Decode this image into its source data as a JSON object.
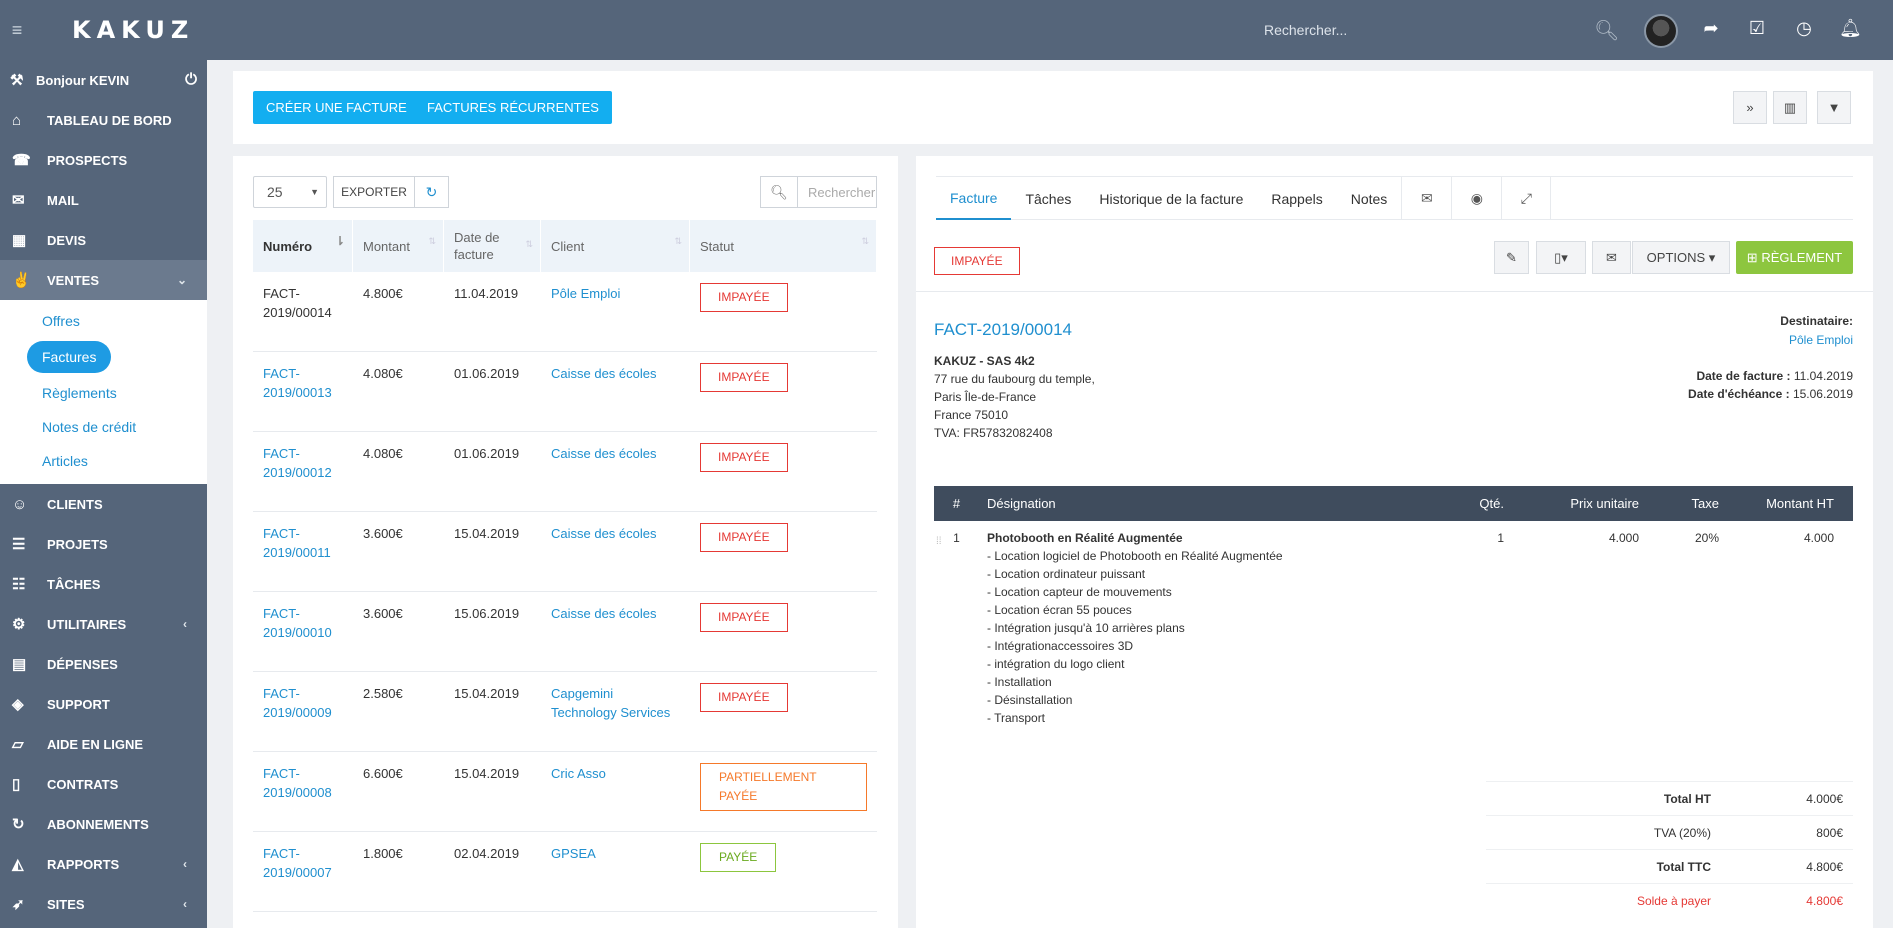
{
  "app": {
    "logo": "KAKUZ",
    "search_placeholder": "Rechercher..."
  },
  "sidebar": {
    "greeting": "Bonjour KEVIN",
    "items_top": [
      {
        "label": "TABLEAU DE BORD",
        "icon": "home-icon"
      },
      {
        "label": "PROSPECTS",
        "icon": "phone-icon"
      },
      {
        "label": "MAIL",
        "icon": "mail-icon"
      },
      {
        "label": "DEVIS",
        "icon": "calculator-icon"
      }
    ],
    "ventes": {
      "label": "VENTES",
      "icon": "victory-hand-icon",
      "sub": [
        "Offres",
        "Factures",
        "Règlements",
        "Notes de crédit",
        "Articles"
      ]
    },
    "items_bottom": [
      {
        "label": "CLIENTS",
        "icon": "user-icon"
      },
      {
        "label": "PROJETS",
        "icon": "bars-icon"
      },
      {
        "label": "TÂCHES",
        "icon": "tasks-icon"
      },
      {
        "label": "UTILITAIRES",
        "icon": "gears-icon"
      },
      {
        "label": "DÉPENSES",
        "icon": "file-icon"
      },
      {
        "label": "SUPPORT",
        "icon": "ticket-icon"
      },
      {
        "label": "AIDE EN LIGNE",
        "icon": "folder-open-icon"
      },
      {
        "label": "CONTRATS",
        "icon": "document-icon"
      },
      {
        "label": "ABONNEMENTS",
        "icon": "refresh-icon"
      },
      {
        "label": "RAPPORTS",
        "icon": "area-chart-icon"
      },
      {
        "label": "SITES",
        "icon": "rocket-icon"
      }
    ]
  },
  "toolbar": {
    "create_invoice": "CRÉER UNE FACTURE",
    "recurring_invoices": "FACTURES RÉCURRENTES"
  },
  "list": {
    "page_size": "25",
    "export_label": "EXPORTER",
    "search_placeholder": "Rechercher",
    "columns": [
      "Numéro",
      "Montant",
      "Date de facture",
      "Client",
      "Statut"
    ],
    "rows": [
      {
        "num": "FACT-2019/00014",
        "amount": "4.800€",
        "date": "11.04.2019",
        "client": "Pôle Emploi",
        "status": "IMPAYÉE"
      },
      {
        "num": "FACT-2019/00013",
        "amount": "4.080€",
        "date": "01.06.2019",
        "client": "Caisse des écoles",
        "status": "IMPAYÉE"
      },
      {
        "num": "FACT-2019/00012",
        "amount": "4.080€",
        "date": "01.06.2019",
        "client": "Caisse des écoles",
        "status": "IMPAYÉE"
      },
      {
        "num": "FACT-2019/00011",
        "amount": "3.600€",
        "date": "15.04.2019",
        "client": "Caisse des écoles",
        "status": "IMPAYÉE"
      },
      {
        "num": "FACT-2019/00010",
        "amount": "3.600€",
        "date": "15.06.2019",
        "client": "Caisse des écoles",
        "status": "IMPAYÉE"
      },
      {
        "num": "FACT-2019/00009",
        "amount": "2.580€",
        "date": "15.04.2019",
        "client": "Capgemini Technology Services",
        "status": "IMPAYÉE"
      },
      {
        "num": "FACT-2019/00008",
        "amount": "6.600€",
        "date": "15.04.2019",
        "client": "Cric Asso",
        "status": "PARTIELLEMENT PAYÉE"
      },
      {
        "num": "FACT-2019/00007",
        "amount": "1.800€",
        "date": "02.04.2019",
        "client": "GPSEA",
        "status": "PAYÉE"
      }
    ]
  },
  "detail": {
    "tabs": [
      "Facture",
      "Tâches",
      "Historique de la facture",
      "Rappels",
      "Notes"
    ],
    "status": "IMPAYÉE",
    "options_label": "OPTIONS",
    "payment_label": "RÈGLEMENT",
    "invoice_number": "FACT-2019/00014",
    "company": {
      "name": "KAKUZ - SAS 4k2",
      "address1": "77 rue du faubourg du temple,",
      "address2": "Paris Île-de-France",
      "address3": "France 75010",
      "vat": "TVA: FR57832082408"
    },
    "recipient_label": "Destinataire:",
    "recipient": "Pôle Emploi",
    "invoice_date_label": "Date de facture :",
    "invoice_date": "11.04.2019",
    "due_date_label": "Date d'échéance :",
    "due_date": "15.06.2019",
    "line_headers": [
      "#",
      "Désignation",
      "Qté.",
      "Prix unitaire",
      "Taxe",
      "Montant HT"
    ],
    "line": {
      "index": "1",
      "title": "Photobooth en Réalité Augmentée",
      "description": [
        "- Location logiciel de Photobooth en Réalité Augmentée",
        "- Location ordinateur puissant",
        "- Location capteur de mouvements",
        "- Location écran 55 pouces",
        "- Intégration jusqu'à 10 arrières plans",
        "- Intégrationaccessoires 3D",
        "- intégration du logo client",
        "- Installation",
        "- Désinstallation",
        "- Transport"
      ],
      "qty": "1",
      "unit_price": "4.000",
      "tax": "20%",
      "amount": "4.000"
    },
    "totals": [
      {
        "label": "Total HT",
        "value": "4.000€"
      },
      {
        "label": "TVA (20%)",
        "value": "800€"
      },
      {
        "label": "Total TTC",
        "value": "4.800€"
      },
      {
        "label": "Solde à payer",
        "value": "4.800€"
      }
    ]
  },
  "colors": {
    "topbar": "#55657a",
    "primary": "#13aef0",
    "link": "#1f8fcf",
    "danger": "#e53935",
    "warning": "#f5792a",
    "success": "#8dc63f"
  }
}
